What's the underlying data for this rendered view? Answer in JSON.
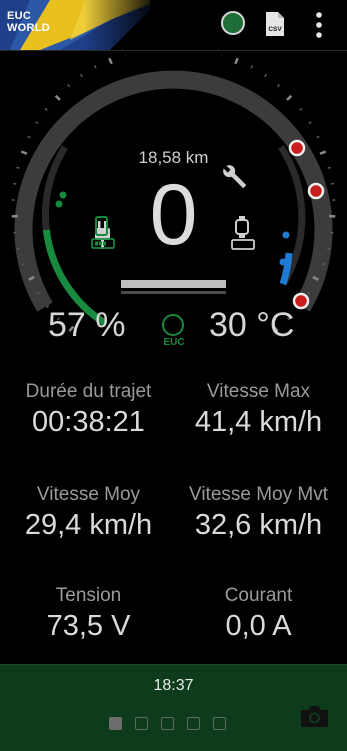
{
  "app": {
    "logo_line1": "EUC",
    "logo_line2": "WORLD"
  },
  "toolbar": {
    "status_icon": "connection-status-icon",
    "export_icon": "csv-file-icon",
    "export_icon_text": "CSV",
    "menu_icon": "more-vert-icon"
  },
  "gauge": {
    "distance": "18,58 km",
    "speed": "0",
    "battery": "57 %",
    "temperature": "30 °C",
    "euc_label": "EUC",
    "battery_level": 0.57,
    "icons": [
      "plug-icon",
      "wrench-icon",
      "phone-icon",
      "phone-battery-icon",
      "watch-icon",
      "watch-battery-icon"
    ]
  },
  "stats": [
    {
      "label": "Durée du trajet",
      "value": "00:38:21"
    },
    {
      "label": "Vitesse Max",
      "value": "41,4 km/h"
    },
    {
      "label": "Vitesse Moy",
      "value": "29,4 km/h"
    },
    {
      "label": "Vitesse Moy Mvt",
      "value": "32,6 km/h"
    },
    {
      "label": "Tension",
      "value": "73,5 V"
    },
    {
      "label": "Courant",
      "value": "0,0 A"
    }
  ],
  "footer": {
    "time": "18:37",
    "pages": 5,
    "active_page": 1,
    "camera_icon": "camera-icon"
  },
  "colors": {
    "accent_green": "#178a3e",
    "alarm_red": "#c81e1e",
    "temp_blue": "#1e7ad2",
    "footer_bg": "#0d3b1c"
  }
}
